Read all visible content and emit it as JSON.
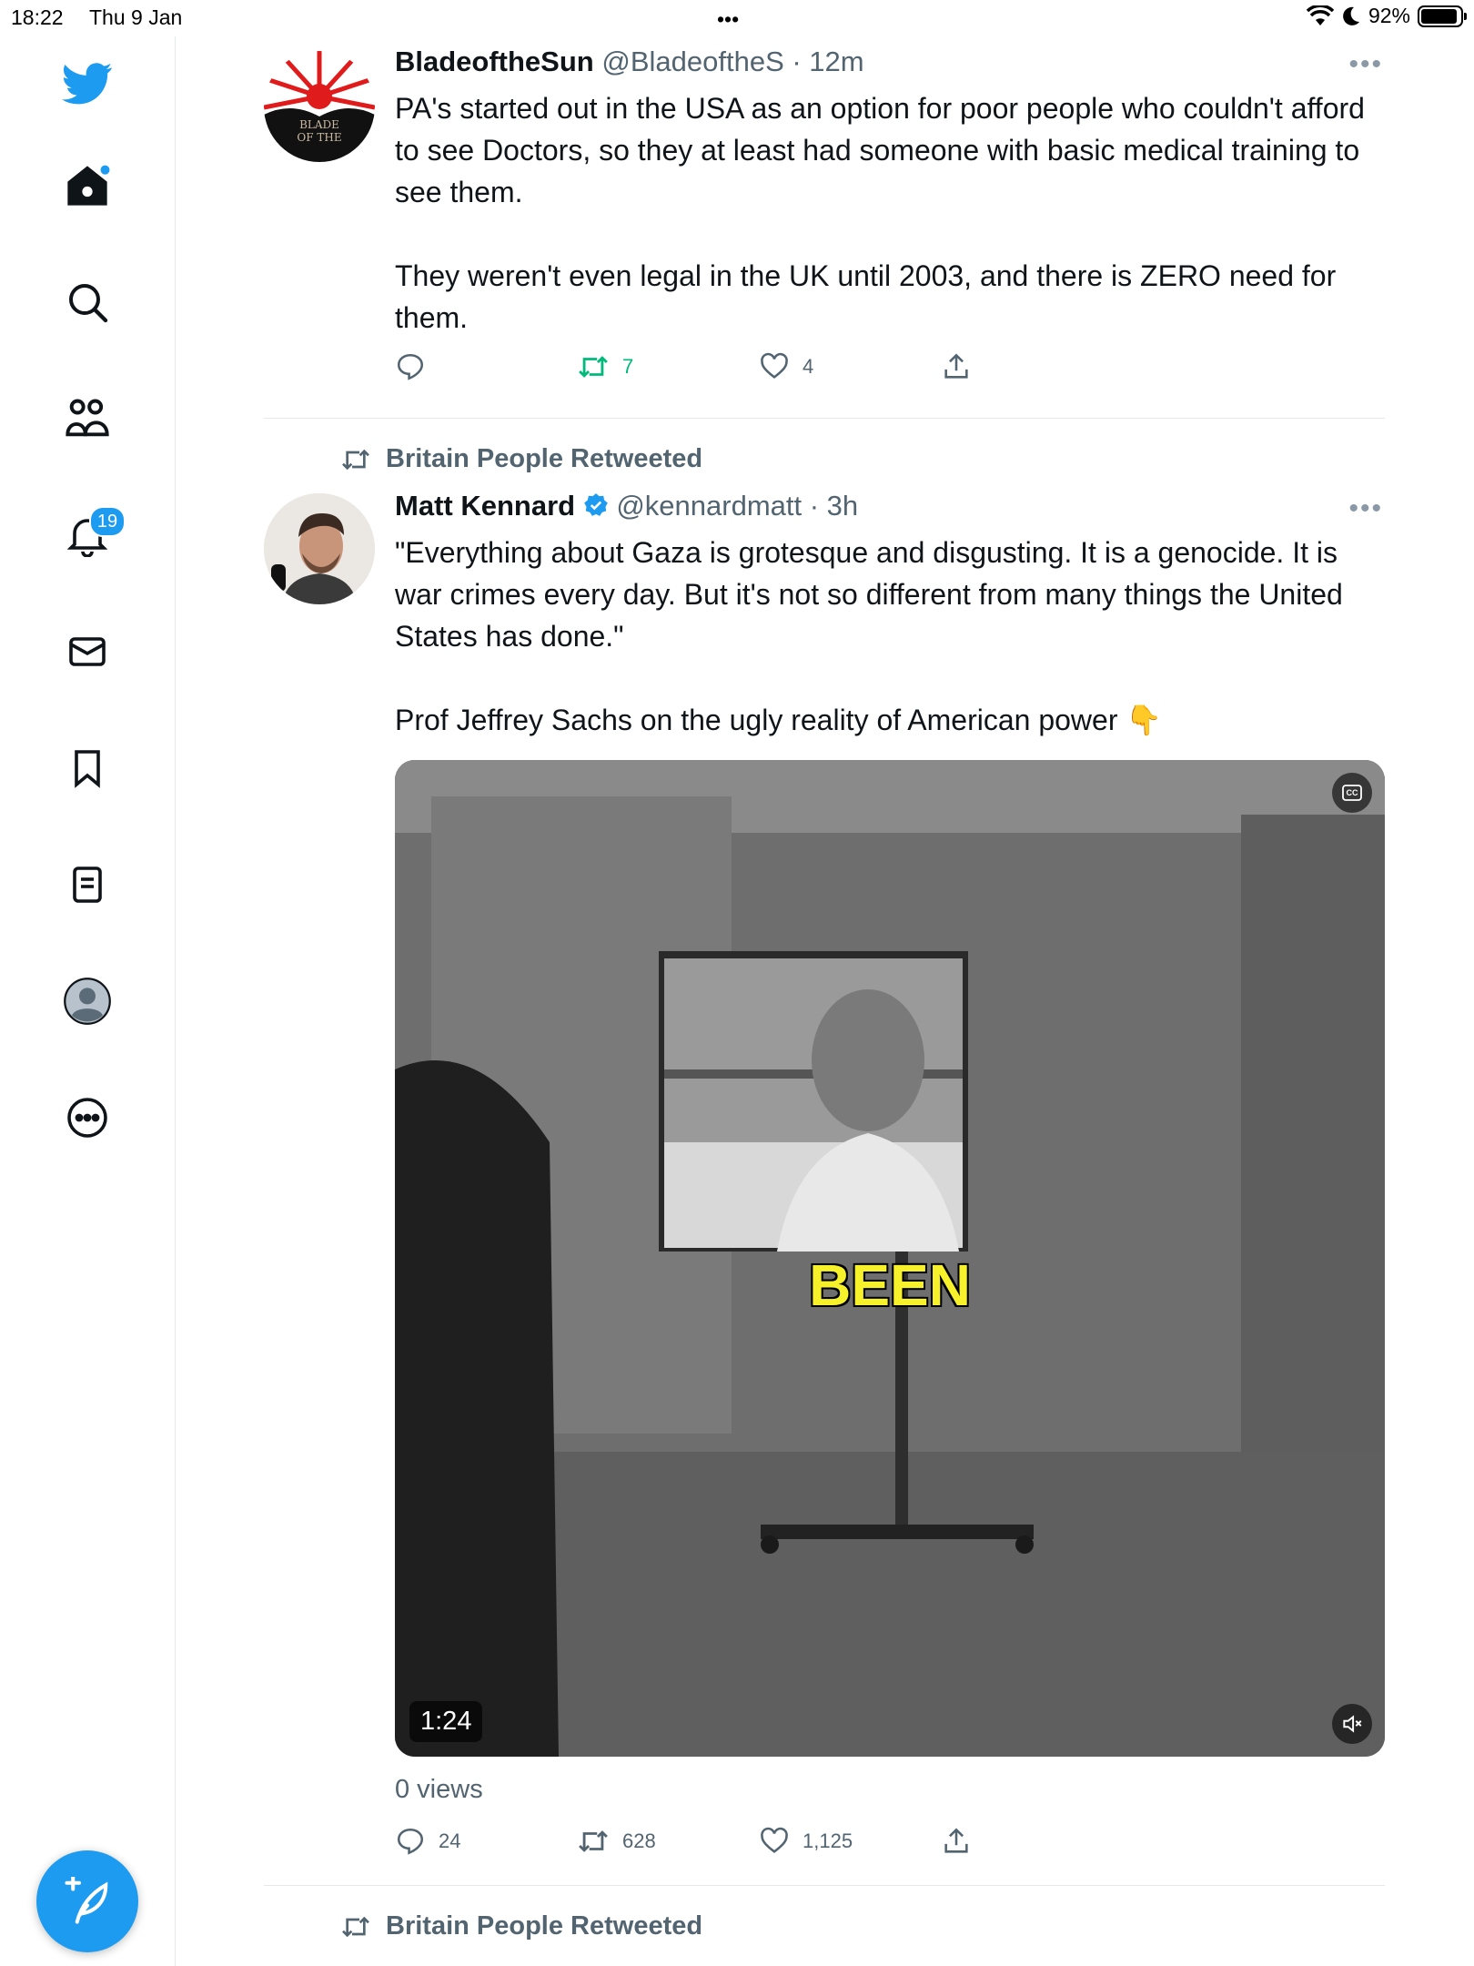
{
  "status_bar": {
    "time": "18:22",
    "date": "Thu 9 Jan",
    "dots": "•••",
    "battery": "92%",
    "battery_fraction": 0.92
  },
  "sidebar": {
    "items": [
      "twitter-logo",
      "home",
      "explore",
      "communities",
      "notifications",
      "messages",
      "bookmarks",
      "lists",
      "profile",
      "more"
    ],
    "notifications_badge": "19"
  },
  "tweets": [
    {
      "name": "BladeoftheSun",
      "handle": "@BladeoftheS",
      "time": "· 12m",
      "avatar_text": "BLADE\nOF THE",
      "text": "PA's started out in the USA as an option for poor people who couldn't afford to see Doctors, so they at least had someone with basic medical training to see them.\n\nThey weren't even legal in the UK until 2003, and there is ZERO need for them.",
      "retweets": "7",
      "likes": "4"
    },
    {
      "retweeted_by": "Britain People Retweeted",
      "name": "Matt Kennard",
      "handle": "@kennardmatt",
      "time": "· 3h",
      "text": "\"Everything about Gaza is grotesque and disgusting. It is a genocide. It is war crimes every day. But it's not so different from many things the United States has done.\"\n\nProf Jeffrey Sachs on the ugly reality of American power 👇",
      "video": {
        "caption": "BEEN",
        "duration": "1:24",
        "cc": "CC"
      },
      "views": "0 views",
      "replies": "24",
      "retweets": "628",
      "likes": "1,125"
    },
    {
      "retweeted_by": "Britain People Retweeted"
    }
  ],
  "more_label": "•••",
  "colors": {
    "accent": "#1d9bf0",
    "retweet_green": "#00ba7c",
    "secondary_text": "#536471"
  }
}
